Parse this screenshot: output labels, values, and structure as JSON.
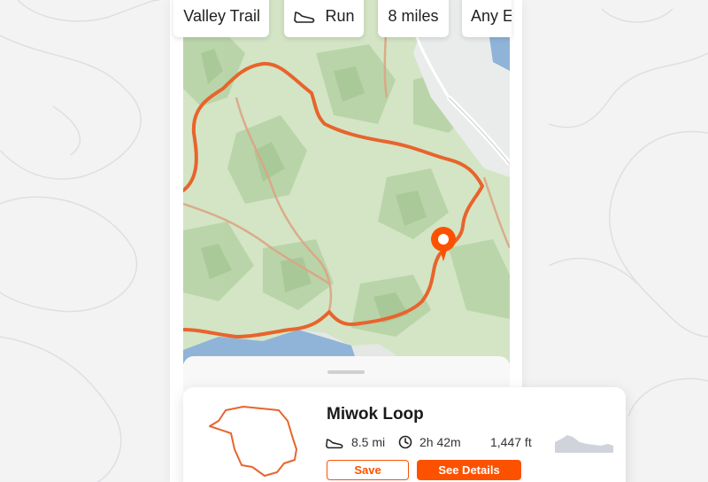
{
  "filters": {
    "trail": "Valley Trail",
    "activity": "Run",
    "distance": "8 miles",
    "surface": "Any E"
  },
  "route_card": {
    "name": "Miwok Loop",
    "distance": "8.5 mi",
    "duration": "2h 42m",
    "elevation": "1,447 ft",
    "save_label": "Save",
    "details_label": "See Details"
  },
  "colors": {
    "accent": "#fc5200",
    "route": "#e8642c",
    "map_green": "#cfe3c0",
    "water": "#8fb4d8"
  },
  "icons": {
    "activity": "shoe-icon",
    "distance": "shoe-icon",
    "duration": "clock-icon",
    "map_marker": "location-pin-icon"
  }
}
